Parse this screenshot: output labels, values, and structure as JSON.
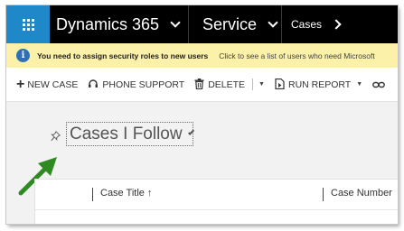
{
  "navbar": {
    "app_name": "Dynamics 365",
    "area_name": "Service",
    "entity_name": "Cases"
  },
  "notification": {
    "message": "You need to assign security roles to new users",
    "link_text": "Click to see a list of users who need Microsoft"
  },
  "commands": {
    "new_case": "NEW CASE",
    "phone_support": "PHONE SUPPORT",
    "delete": "DELETE",
    "run_report": "RUN REPORT"
  },
  "view": {
    "title": "Cases I Follow"
  },
  "grid": {
    "columns": [
      {
        "label": "Case Title",
        "sort": "↑"
      },
      {
        "label": "Case Number"
      }
    ]
  },
  "colors": {
    "nav_bg": "#000000",
    "waffle_bg": "#1e88c8",
    "notification_bg": "#fbf1a8",
    "info_icon": "#2f6fb8",
    "arrow": "#2e8b22",
    "view_focus_border": "#1f7fc5"
  },
  "icons": {
    "waffle": "app-launcher-icon",
    "info": "info-icon",
    "new": "plus-icon",
    "phone": "headset-icon",
    "delete": "trash-icon",
    "report": "report-icon",
    "more": "link-icon",
    "pin": "pin-icon"
  }
}
